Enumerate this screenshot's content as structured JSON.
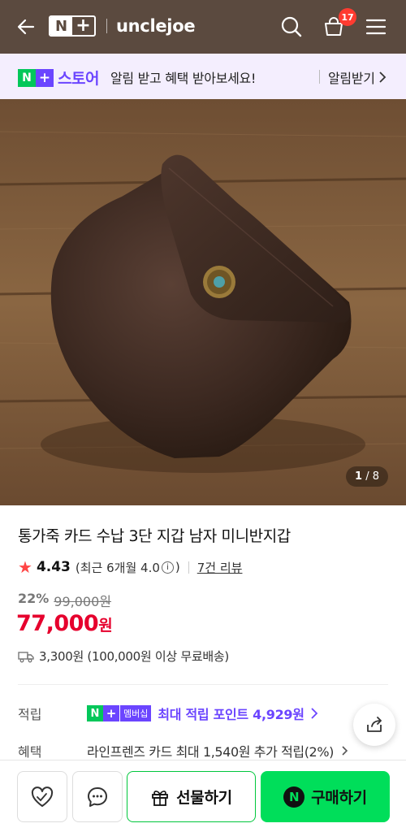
{
  "header": {
    "logo_n": "N",
    "logo_plus": "+",
    "brand": "unclejoe",
    "cart_count": "17",
    "bg_color": "#5b4a3f"
  },
  "promo": {
    "logo_n": "N",
    "logo_plus": "+",
    "store": "스토어",
    "text": "알림 받고 혜택 받아보세요!",
    "cta": "알림받기"
  },
  "gallery": {
    "current": "1",
    "separator": "/",
    "total": "8"
  },
  "product": {
    "title": "통가죽 카드 수납 3단 지갑 남자 미니반지갑",
    "rating": "4.43",
    "rating_note_prefix": "(최근 6개월 4.0",
    "rating_note_suffix": ")",
    "reviews": "7건 리뷰",
    "discount_pct": "22%",
    "original_price": "99,000원",
    "price": "77,000",
    "price_unit": "원",
    "shipping": "3,300원 (100,000원 이상 무료배송)"
  },
  "benefits": {
    "points_label": "적립",
    "membership_n": "N",
    "membership_plus": "+",
    "membership_badge": "멤버십",
    "points_text": "최대 적립 포인트 4,929원",
    "benefit_label": "혜택",
    "benefit_text": "라인프렌즈 카드 최대 1,540원 추가 적립(2%)"
  },
  "bottom_bar": {
    "gift_label": "선물하기",
    "buy_n": "N",
    "buy_label": "구매하기"
  },
  "icons": [
    "back-arrow-icon",
    "search-icon",
    "shopping-bag-icon",
    "menu-icon",
    "chevron-right-icon",
    "star-icon",
    "info-icon",
    "truck-icon",
    "share-icon",
    "heart-icon",
    "chat-icon",
    "gift-icon"
  ],
  "colors": {
    "price": "#e6002d",
    "brand_purple": "#6b45ff",
    "naver_green": "#03c75a",
    "buy_button": "#00de5a"
  }
}
